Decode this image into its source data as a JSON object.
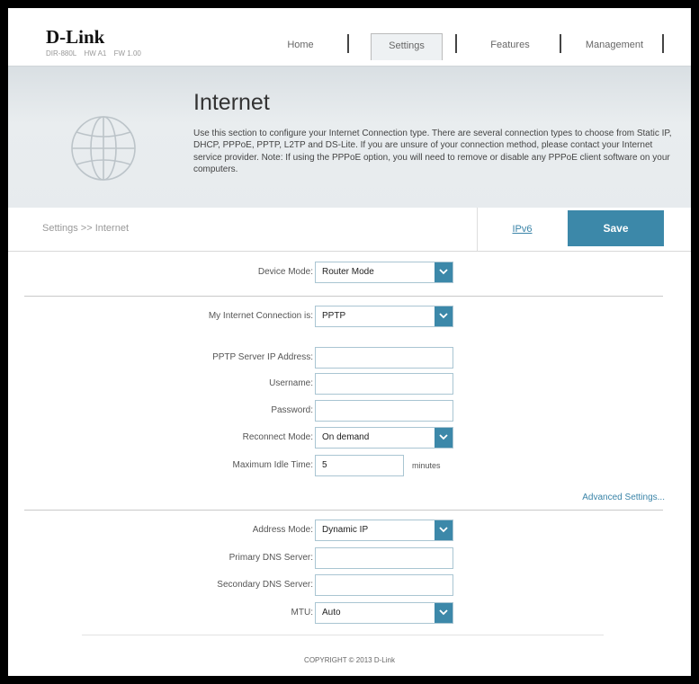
{
  "header": {
    "logo": "D-Link",
    "model": "DIR-880L",
    "hw": "HW A1",
    "fw": "FW 1.00",
    "nav": {
      "home": "Home",
      "settings": "Settings",
      "features": "Features",
      "management": "Management"
    }
  },
  "banner": {
    "title": "Internet",
    "description": "Use this section to configure your Internet Connection type. There are several connection types to choose from Static IP, DHCP, PPPoE, PPTP, L2TP and DS-Lite. If you are unsure of your connection method, please contact your Internet service provider. Note: If using the PPPoE option, you will need to remove or disable any PPPoE client software on your computers."
  },
  "toolbar": {
    "breadcrumb": "Settings >> Internet",
    "ipv6_label": "IPv6",
    "save_label": "Save"
  },
  "form": {
    "device_mode": {
      "label": "Device Mode:",
      "value": "Router Mode"
    },
    "connection": {
      "label": "My Internet Connection is:",
      "value": "PPTP"
    },
    "pptp_server": {
      "label": "PPTP Server IP Address:",
      "value": ""
    },
    "username": {
      "label": "Username:",
      "value": ""
    },
    "password": {
      "label": "Password:",
      "value": ""
    },
    "reconnect_mode": {
      "label": "Reconnect Mode:",
      "value": "On demand"
    },
    "idle_time": {
      "label": "Maximum Idle Time:",
      "value": "5",
      "unit": "minutes"
    },
    "advanced_link": "Advanced Settings...",
    "address_mode": {
      "label": "Address Mode:",
      "value": "Dynamic IP"
    },
    "primary_dns": {
      "label": "Primary DNS Server:",
      "value": ""
    },
    "secondary_dns": {
      "label": "Secondary DNS Server:",
      "value": ""
    },
    "mtu": {
      "label": "MTU:",
      "value": "Auto"
    }
  },
  "footer": {
    "copyright": "COPYRIGHT © 2013 D-Link"
  },
  "colors": {
    "accent": "#3c88a9",
    "link": "#3a84a8"
  }
}
